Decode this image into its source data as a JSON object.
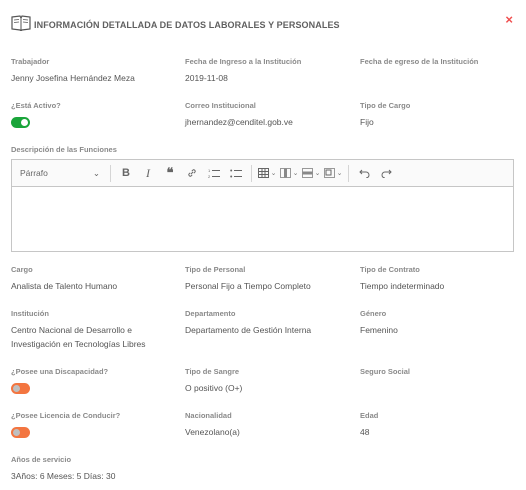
{
  "header": {
    "title": "INFORMACIÓN DETALLADA DE DATOS LABORALES Y PERSONALES",
    "close_label": "×",
    "icon": "book-icon"
  },
  "fields": {
    "trabajador": {
      "label": "Trabajador",
      "value": "Jenny Josefina Hernández Meza"
    },
    "fecha_ingreso": {
      "label": "Fecha de Ingreso a la Institución",
      "value": "2019-11-08"
    },
    "fecha_egreso": {
      "label": "Fecha de egreso de la Institución",
      "value": ""
    },
    "activo": {
      "label": "¿Está Activo?",
      "value": true
    },
    "correo": {
      "label": "Correo Institucional",
      "value": "jhernandez@cenditel.gob.ve"
    },
    "tipo_cargo": {
      "label": "Tipo de Cargo",
      "value": "Fijo"
    },
    "descripcion": {
      "label": "Descripción de las Funciones",
      "value": ""
    },
    "cargo": {
      "label": "Cargo",
      "value": "Analista de Talento Humano"
    },
    "tipo_personal": {
      "label": "Tipo de Personal",
      "value": "Personal Fijo a Tiempo Completo"
    },
    "tipo_contrato": {
      "label": "Tipo de Contrato",
      "value": "Tiempo indeterminado"
    },
    "institucion": {
      "label": "Institución",
      "value": "Centro Nacional de Desarrollo e Investigación en Tecnologías Libres"
    },
    "departamento": {
      "label": "Departamento",
      "value": "Departamento de Gestión Interna"
    },
    "genero": {
      "label": "Género",
      "value": "Femenino"
    },
    "discapacidad": {
      "label": "¿Posee una Discapacidad?",
      "value": false
    },
    "tipo_sangre": {
      "label": "Tipo de Sangre",
      "value": "O positivo (O+)"
    },
    "seguro_social": {
      "label": "Seguro Social",
      "value": ""
    },
    "licencia": {
      "label": "¿Posee Licencia de Conducir?",
      "value": false
    },
    "nacionalidad": {
      "label": "Nacionalidad",
      "value": "Venezolano(a)"
    },
    "edad": {
      "label": "Edad",
      "value": "48"
    },
    "anos_servicio": {
      "label": "Años de servicio",
      "value": "3Años: 6 Meses: 5 Días: 30"
    }
  },
  "editor": {
    "format_select": "Párrafo",
    "buttons": [
      "bold-icon",
      "italic-icon",
      "blockquote-icon",
      "link-icon",
      "numbered-list-icon",
      "bulleted-list-icon",
      "insert-table-icon",
      "table-column-icon",
      "table-row-icon",
      "merge-cells-icon",
      "undo-icon",
      "redo-icon"
    ]
  },
  "colors": {
    "toggle_on": "#1aa53a",
    "toggle_off": "#f37540",
    "close": "#f04e4e"
  }
}
